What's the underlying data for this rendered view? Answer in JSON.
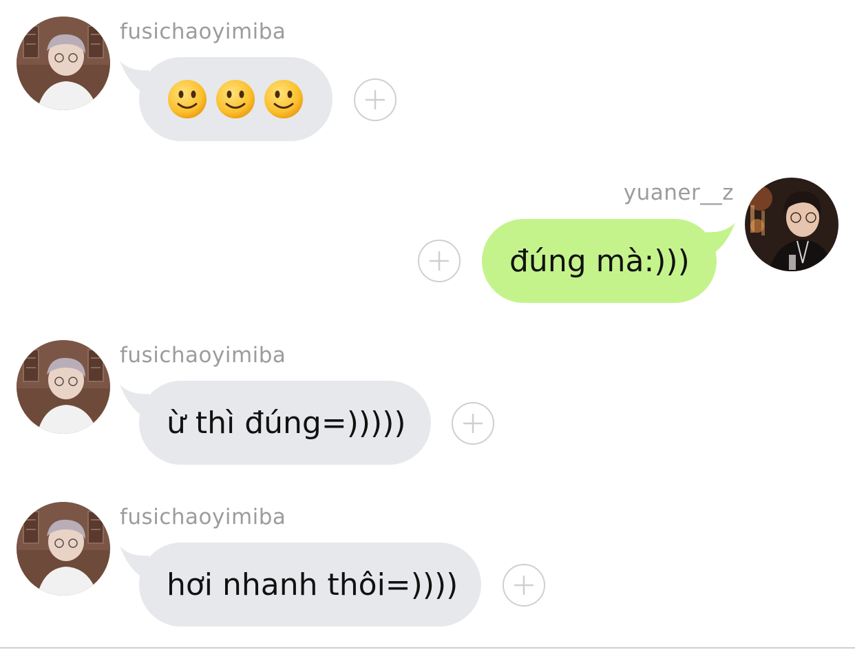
{
  "colors": {
    "incoming_bubble": "#e6e8eb",
    "outgoing_bubble": "#c4f38c",
    "username_text": "#9c9c9c",
    "message_text": "#111111",
    "plus_button_border": "#cfcfcf"
  },
  "messages": [
    {
      "direction": "incoming",
      "username": "fusichaoyimiba",
      "text": "",
      "emojis": [
        "slightly-smiling-face",
        "slightly-smiling-face",
        "slightly-smiling-face"
      ],
      "avatar_icon": "avatar-photo-fusichaoyimiba",
      "action_icon": "plus-icon"
    },
    {
      "direction": "outgoing",
      "username": "yuaner__z",
      "text": "đúng mà:)))",
      "avatar_icon": "avatar-photo-yuaner",
      "action_icon": "plus-icon"
    },
    {
      "direction": "incoming",
      "username": "fusichaoyimiba",
      "text": "ừ thì đúng=)))))",
      "avatar_icon": "avatar-photo-fusichaoyimiba",
      "action_icon": "plus-icon"
    },
    {
      "direction": "incoming",
      "username": "fusichaoyimiba",
      "text": "hơi nhanh thôi=))))",
      "avatar_icon": "avatar-photo-fusichaoyimiba",
      "action_icon": "plus-icon"
    }
  ]
}
